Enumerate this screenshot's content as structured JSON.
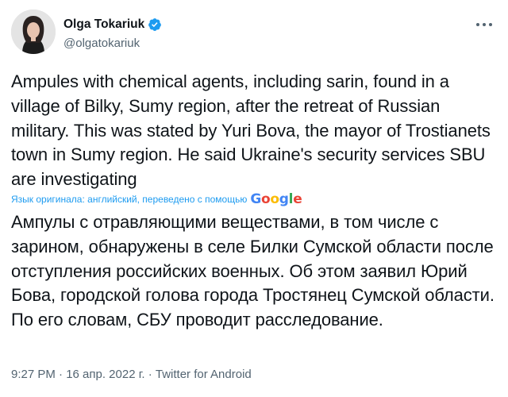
{
  "author": {
    "name": "Olga Tokariuk",
    "handle": "@olgatokariuk"
  },
  "tweet": {
    "original_text": "Ampules with chemical agents, including sarin, found in a village of Bilky, Sumy region, after the retreat of Russian military. This was stated by Yuri Bova, the mayor of Trostianets town in Sumy region. He said Ukraine's security services SBU are investigating",
    "translation_note": "Язык оригинала: английский, переведено с помощью",
    "translation_provider": {
      "g1": "G",
      "o1": "o",
      "o2": "o",
      "g2": "g",
      "l": "l",
      "e": "e"
    },
    "translated_text": "Ампулы с отравляющими веществами, в том числе с зарином, обнаружены в селе Билки Сумской области после отступления российских военных. Об этом заявил Юрий Бова, городской голова города Тростянец Сумской области. По его словам, СБУ проводит расследование.",
    "timestamp": "9:27 PM · 16 апр. 2022 г. · Twitter for Android"
  },
  "icons": {
    "avatar": "profile-photo",
    "verified": "verified-badge-icon",
    "more": "more-options-icon"
  },
  "colors": {
    "text": "#0f1419",
    "secondary": "#536471",
    "accent": "#1d9bf0"
  }
}
